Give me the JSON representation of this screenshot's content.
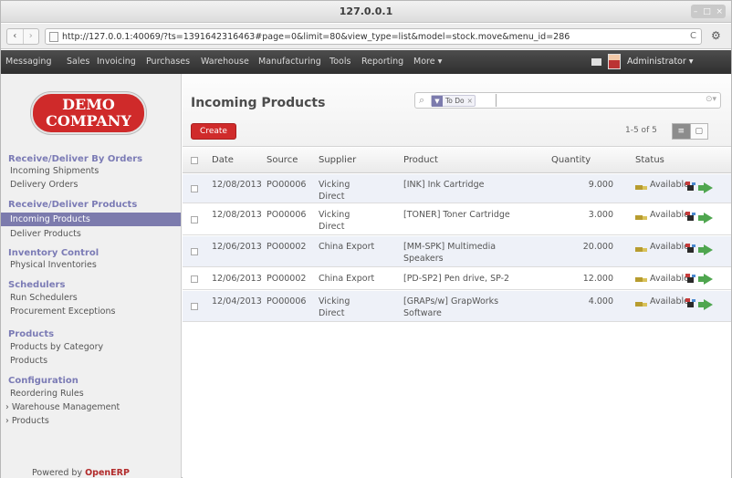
{
  "window": {
    "title": "127.0.0.1"
  },
  "browser": {
    "back": "‹",
    "forward": "›",
    "url": "http://127.0.0.1:40069/?ts=1391642316463#page=0&limit=80&view_type=list&model=stock.move&menu_id=286",
    "reload": "C",
    "settings_icon": "gear-icon"
  },
  "menu": {
    "items": [
      "Messaging",
      "Sales",
      "Invoicing",
      "Purchases",
      "Warehouse",
      "Manufacturing",
      "Tools",
      "Reporting",
      "More ▾"
    ],
    "user": "Administrator ▾"
  },
  "logo": {
    "line1": "DEMO",
    "line2": "COMPANY"
  },
  "sidebar": {
    "sections": [
      {
        "title": "Receive/Deliver By Orders",
        "items": [
          "Incoming Shipments",
          "Delivery Orders"
        ]
      },
      {
        "title": "Receive/Deliver Products",
        "items": [
          "Incoming Products",
          "Deliver Products"
        ]
      },
      {
        "title": "Inventory Control",
        "items": [
          "Physical Inventories"
        ]
      },
      {
        "title": "Schedulers",
        "items": [
          "Run Schedulers",
          "Procurement Exceptions"
        ]
      },
      {
        "title": "Products",
        "items": [
          "Products by Category",
          "Products"
        ]
      },
      {
        "title": "Configuration",
        "items": [
          "Reordering Rules",
          "› Warehouse Management",
          "› Products"
        ]
      }
    ],
    "active_item": "Incoming Products",
    "powered_by": "Powered by",
    "powered_brand": "OpenERP"
  },
  "main": {
    "title": "Incoming Products",
    "search_facet": "To Do",
    "search_value": "",
    "create_label": "Create",
    "pager": "1-5 of 5",
    "view_list": "≡",
    "view_form": "▢"
  },
  "table": {
    "columns": [
      "Date",
      "Source",
      "Supplier",
      "Product",
      "Quantity",
      "Status"
    ],
    "rows": [
      {
        "date": "12/08/2013",
        "source": "PO00006",
        "supplier": "Vicking Direct",
        "product": "[INK] Ink Cartridge",
        "quantity": "9.000",
        "status": "Available"
      },
      {
        "date": "12/08/2013",
        "source": "PO00006",
        "supplier": "Vicking Direct",
        "product": "[TONER] Toner Cartridge",
        "quantity": "3.000",
        "status": "Available"
      },
      {
        "date": "12/06/2013",
        "source": "PO00002",
        "supplier": "China Export",
        "product": "[MM-SPK] Multimedia Speakers",
        "quantity": "20.000",
        "status": "Available"
      },
      {
        "date": "12/06/2013",
        "source": "PO00002",
        "supplier": "China Export",
        "product": "[PD-SP2] Pen drive, SP-2",
        "quantity": "12.000",
        "status": "Available"
      },
      {
        "date": "12/04/2013",
        "source": "PO00006",
        "supplier": "Vicking Direct",
        "product": "[GRAPs/w] GrapWorks Software",
        "quantity": "4.000",
        "status": "Available"
      }
    ]
  },
  "colors": {
    "accent": "#7c7bad",
    "create": "#d02b2b",
    "menubar": "#3a3a3a"
  }
}
